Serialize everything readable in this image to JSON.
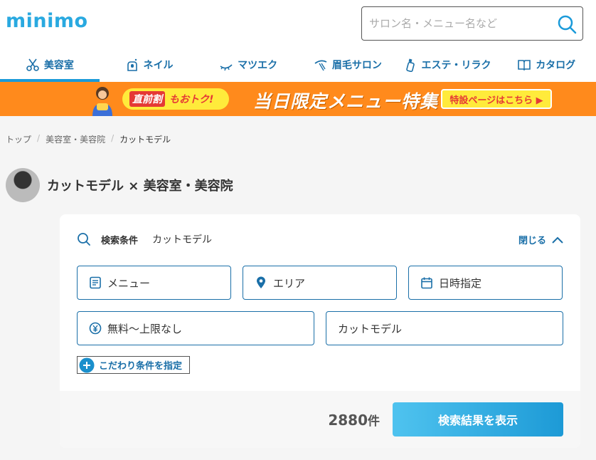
{
  "header": {
    "logo": "minimo",
    "search_placeholder": "サロン名・メニュー名など"
  },
  "nav": {
    "items": [
      {
        "label": "美容室",
        "icon": "scissors-icon",
        "active": true
      },
      {
        "label": "ネイル",
        "icon": "nail-icon",
        "active": false
      },
      {
        "label": "マツエク",
        "icon": "eyelash-icon",
        "active": false
      },
      {
        "label": "眉毛サロン",
        "icon": "eyebrow-icon",
        "active": false
      },
      {
        "label": "エステ・リラク",
        "icon": "bottle-icon",
        "active": false
      },
      {
        "label": "カタログ",
        "icon": "book-icon",
        "active": false
      }
    ]
  },
  "banner": {
    "pill_a": "直前割",
    "pill_b": "もおトク!",
    "title": "当日限定メニュー特集",
    "cta": "特設ページはこちら ▶"
  },
  "breadcrumb": {
    "items": [
      "トップ",
      "美容室・美容院",
      "カットモデル"
    ],
    "separator": "/"
  },
  "page": {
    "title": "カットモデル × 美容室・美容院"
  },
  "search_panel": {
    "cond_label": "検索条件",
    "cond_value": "カットモデル",
    "close_label": "閉じる",
    "fields": {
      "menu": "メニュー",
      "area": "エリア",
      "date": "日時指定",
      "price": "無料〜上限なし",
      "keyword": "カットモデル"
    },
    "more_conditions": "こだわり条件を指定",
    "count": "2880",
    "count_unit": "件",
    "result_button": "検索結果を表示"
  },
  "colors": {
    "brand": "#29a9e0",
    "nav_text": "#1a6fa8",
    "banner_bg": "#ff8a1c",
    "button_gradient_start": "#4fc3ef",
    "button_gradient_end": "#1d9ad6"
  }
}
